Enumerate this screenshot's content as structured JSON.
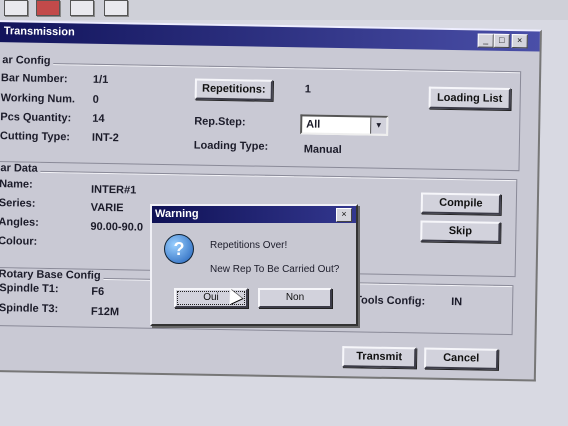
{
  "window": {
    "title": "Transmission",
    "min_glyph": "_",
    "max_glyph": "□",
    "close_glyph": "×"
  },
  "bar_config": {
    "group_label": "ar Config",
    "bar_number_label": "Bar Number:",
    "bar_number_value": "1/1",
    "working_num_label": "Working Num.",
    "working_num_value": "0",
    "pcs_quantity_label": "Pcs Quantity:",
    "pcs_quantity_value": "14",
    "cutting_type_label": "Cutting Type:",
    "cutting_type_value": "INT-2",
    "repetitions_button": "Repetitions:",
    "repetitions_value": "1",
    "rep_step_label": "Rep.Step:",
    "rep_step_selected": "All",
    "loading_type_label": "Loading Type:",
    "loading_type_value": "Manual",
    "loading_list_button": "Loading List"
  },
  "bar_data": {
    "group_label": "ar Data",
    "name_label": "Name:",
    "name_value": "INTER#1",
    "series_label": "Series:",
    "series_value": "VARIE",
    "angles_label": "Angles:",
    "angles_value": "90.00-90.0",
    "colour_label": "Colour:",
    "compile_button": "Compile",
    "skip_button": "Skip"
  },
  "rotary": {
    "group_label": "Rotary Base Config",
    "spindle_t1_label": "Spindle T1:",
    "spindle_t1_value": "F6",
    "spindle_t3_label": "Spindle T3:",
    "spindle_t3_value": "F12M",
    "tools_config_label": "Tools Config:",
    "tools_config_value": "IN"
  },
  "footer": {
    "transmit_button": "Transmit",
    "cancel_button": "Cancel"
  },
  "dialog": {
    "title": "Warning",
    "close_glyph": "×",
    "icon_glyph": "?",
    "line1": "Repetitions Over!",
    "line2": "New Rep To Be Carried Out?",
    "yes_button": "Oui",
    "no_button": "Non"
  },
  "colors": {
    "titlebar": "#11135a",
    "window_bg": "#c9c9d4"
  }
}
